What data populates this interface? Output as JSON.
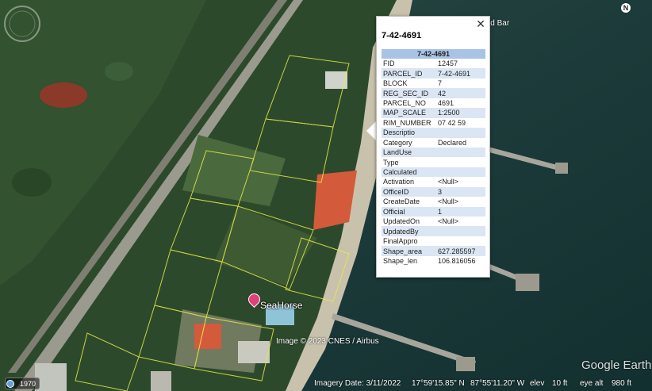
{
  "map": {
    "place_label": "SeaHorse",
    "copyright": "Image © 2023 CNES / Airbus",
    "top_label": "nt and Bar",
    "compass_letter": "N"
  },
  "popup": {
    "title": "7-42-4691",
    "close_icon": "close-icon",
    "table_header": "7-42-4691",
    "rows": [
      {
        "key": "FID",
        "value": "12457"
      },
      {
        "key": "PARCEL_ID",
        "value": "7-42-4691"
      },
      {
        "key": "BLOCK",
        "value": "7"
      },
      {
        "key": "REG_SEC_ID",
        "value": "42"
      },
      {
        "key": "PARCEL_NO",
        "value": "4691"
      },
      {
        "key": "MAP_SCALE",
        "value": "1:2500"
      },
      {
        "key": "RIM_NUMBER",
        "value": "07 42 59"
      },
      {
        "key": "Descriptio",
        "value": ""
      },
      {
        "key": "Category",
        "value": "Declared"
      },
      {
        "key": "LandUse",
        "value": ""
      },
      {
        "key": "Type",
        "value": ""
      },
      {
        "key": "Calculated",
        "value": ""
      },
      {
        "key": "Activation",
        "value": "<Null>"
      },
      {
        "key": "OfficeID",
        "value": "3"
      },
      {
        "key": "CreateDate",
        "value": "<Null>"
      },
      {
        "key": "Official",
        "value": "1"
      },
      {
        "key": "UpdatedOn",
        "value": "<Null>"
      },
      {
        "key": "UpdatedBy",
        "value": ""
      },
      {
        "key": "FinalAppro",
        "value": ""
      },
      {
        "key": "Shape_area",
        "value": "627.285597"
      },
      {
        "key": "Shape_len",
        "value": "106.816056"
      }
    ]
  },
  "status": {
    "year": "1970",
    "imagery_date": "Imagery Date: 3/11/2022",
    "lat": "17°59'15.85\" N",
    "lon": "87°55'11.20\" W",
    "elev_label": "elev",
    "elev_value": "10 ft",
    "eye_alt_label": "eye alt",
    "eye_alt_value": "980 ft",
    "logo": "Google Earth"
  },
  "colors": {
    "sea": "#1b3c3a",
    "vegetation": "#2c4a2b",
    "road": "#9a9a8e",
    "parcel_line": "#e8e84a",
    "roof": "#d35a3a"
  }
}
